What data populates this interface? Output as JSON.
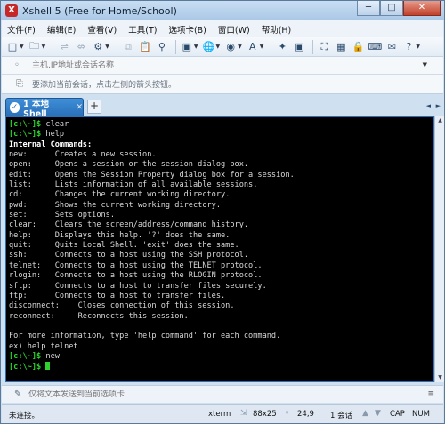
{
  "window": {
    "title": "Xshell 5 (Free for Home/School)",
    "minimize_glyph": "─",
    "maximize_glyph": "□",
    "close_glyph": "✕"
  },
  "menu": {
    "items": [
      "文件(F)",
      "编辑(E)",
      "查看(V)",
      "工具(T)",
      "选项卡(B)",
      "窗口(W)",
      "帮助(H)"
    ]
  },
  "address_bar": {
    "placeholder": "主机,IP地址或会话名称"
  },
  "hint_bar": {
    "text": "要添加当前会话，点击左侧的箭头按钮。"
  },
  "tabs": {
    "active": {
      "label": "1 本地Shell",
      "status_glyph": "✓",
      "close_glyph": "✕"
    },
    "add_glyph": "+",
    "prev_glyph": "◄",
    "next_glyph": "►"
  },
  "terminal": {
    "prompt": "[c:\\~]$",
    "commands": [
      "clear",
      "help",
      "new"
    ],
    "header": "Internal Commands:",
    "help_rows": [
      {
        "cmd": "new:      ",
        "desc": "Creates a new session."
      },
      {
        "cmd": "open:     ",
        "desc": "Opens a session or the session dialog box."
      },
      {
        "cmd": "edit:     ",
        "desc": "Opens the Session Property dialog box for a session."
      },
      {
        "cmd": "list:     ",
        "desc": "Lists information of all available sessions."
      },
      {
        "cmd": "cd:       ",
        "desc": "Changes the current working directory."
      },
      {
        "cmd": "pwd:      ",
        "desc": "Shows the current working directory."
      },
      {
        "cmd": "set:      ",
        "desc": "Sets options."
      },
      {
        "cmd": "clear:    ",
        "desc": "Clears the screen/address/command history."
      },
      {
        "cmd": "help:     ",
        "desc": "Displays this help. '?' does the same."
      },
      {
        "cmd": "quit:     ",
        "desc": "Quits Local Shell. 'exit' does the same."
      },
      {
        "cmd": "ssh:      ",
        "desc": "Connects to a host using the SSH protocol."
      },
      {
        "cmd": "telnet:   ",
        "desc": "Connects to a host using the TELNET protocol."
      },
      {
        "cmd": "rlogin:   ",
        "desc": "Connects to a host using the RLOGIN protocol."
      },
      {
        "cmd": "sftp:     ",
        "desc": "Connects to a host to transfer files securely."
      },
      {
        "cmd": "ftp:      ",
        "desc": "Connects to a host to transfer files."
      },
      {
        "cmd": "disconnect:    ",
        "desc": "Closes connection of this session."
      },
      {
        "cmd": "reconnect:     ",
        "desc": "Reconnects this session."
      }
    ],
    "footer_info": "For more information, type 'help command' for each command.",
    "example": "ex) help telnet"
  },
  "compose_bar": {
    "placeholder": "仅将文本发送到当前选项卡",
    "menu_glyph": "≡"
  },
  "status_bar": {
    "connection": "未连接。",
    "terminal_type": "xterm",
    "size": "88x25",
    "cursor_pos": "24,9",
    "sessions": "1 会话",
    "caps": "CAP",
    "num": "NUM",
    "up_glyph": "▲",
    "down_glyph": "▼",
    "size_icon": "⇲",
    "pos_icon": "⌖"
  },
  "colors": {
    "prompt_green": "#2fd12f",
    "tab_blue": "#2a6fb8",
    "terminal_bg": "#000000"
  }
}
